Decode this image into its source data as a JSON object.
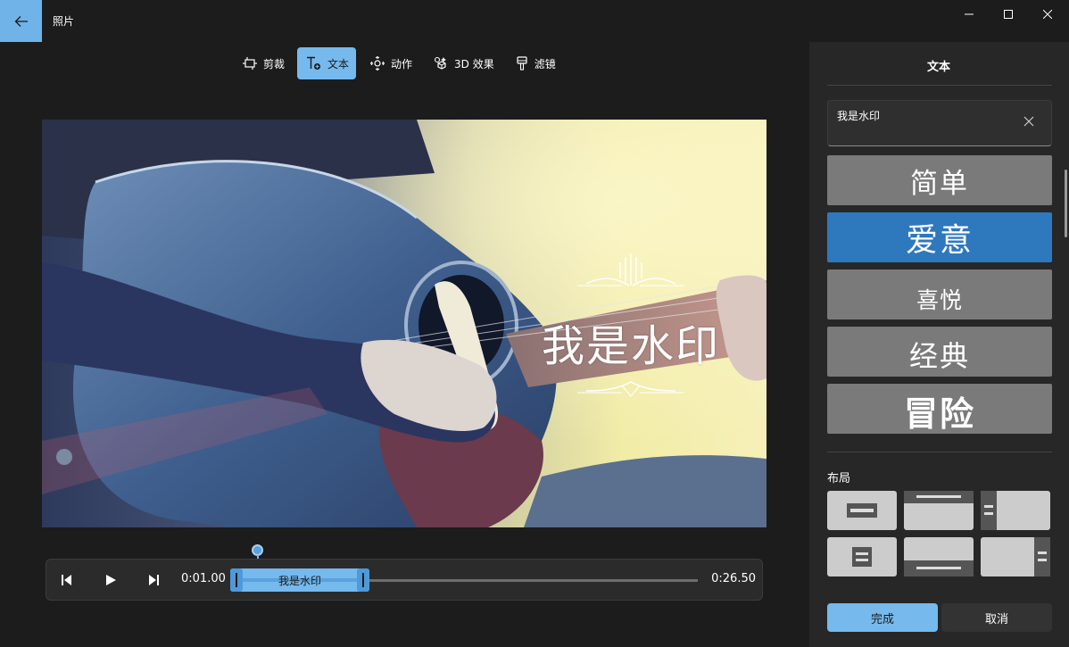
{
  "app": {
    "title": "照片"
  },
  "toolbar": {
    "items": [
      {
        "label": "剪裁",
        "icon": "crop-icon",
        "active": false
      },
      {
        "label": "文本",
        "icon": "text-add-icon",
        "active": true
      },
      {
        "label": "动作",
        "icon": "motion-icon",
        "active": false
      },
      {
        "label": "3D 效果",
        "icon": "3d-effects-icon",
        "active": false
      },
      {
        "label": "滤镜",
        "icon": "filter-brush-icon",
        "active": false
      }
    ]
  },
  "canvas": {
    "watermark_text": "我是水印",
    "image": "person-playing-acoustic-guitar-photo"
  },
  "timeline": {
    "start_time": "0:01.00",
    "end_time": "0:26.50",
    "clip_label": "我是水印"
  },
  "panel": {
    "title": "文本",
    "text_value": "我是水印",
    "styles": [
      {
        "label": "简单",
        "selected": false
      },
      {
        "label": "爱意",
        "selected": true
      },
      {
        "label": "喜悦",
        "selected": false
      },
      {
        "label": "经典",
        "selected": false
      },
      {
        "label": "冒险",
        "selected": false
      }
    ],
    "layout_label": "布局",
    "done_label": "完成",
    "cancel_label": "取消"
  },
  "colors": {
    "accent": "#76b9ed",
    "selected_style": "#2e78bd",
    "background": "#1c1c1c",
    "panel": "#272727"
  }
}
